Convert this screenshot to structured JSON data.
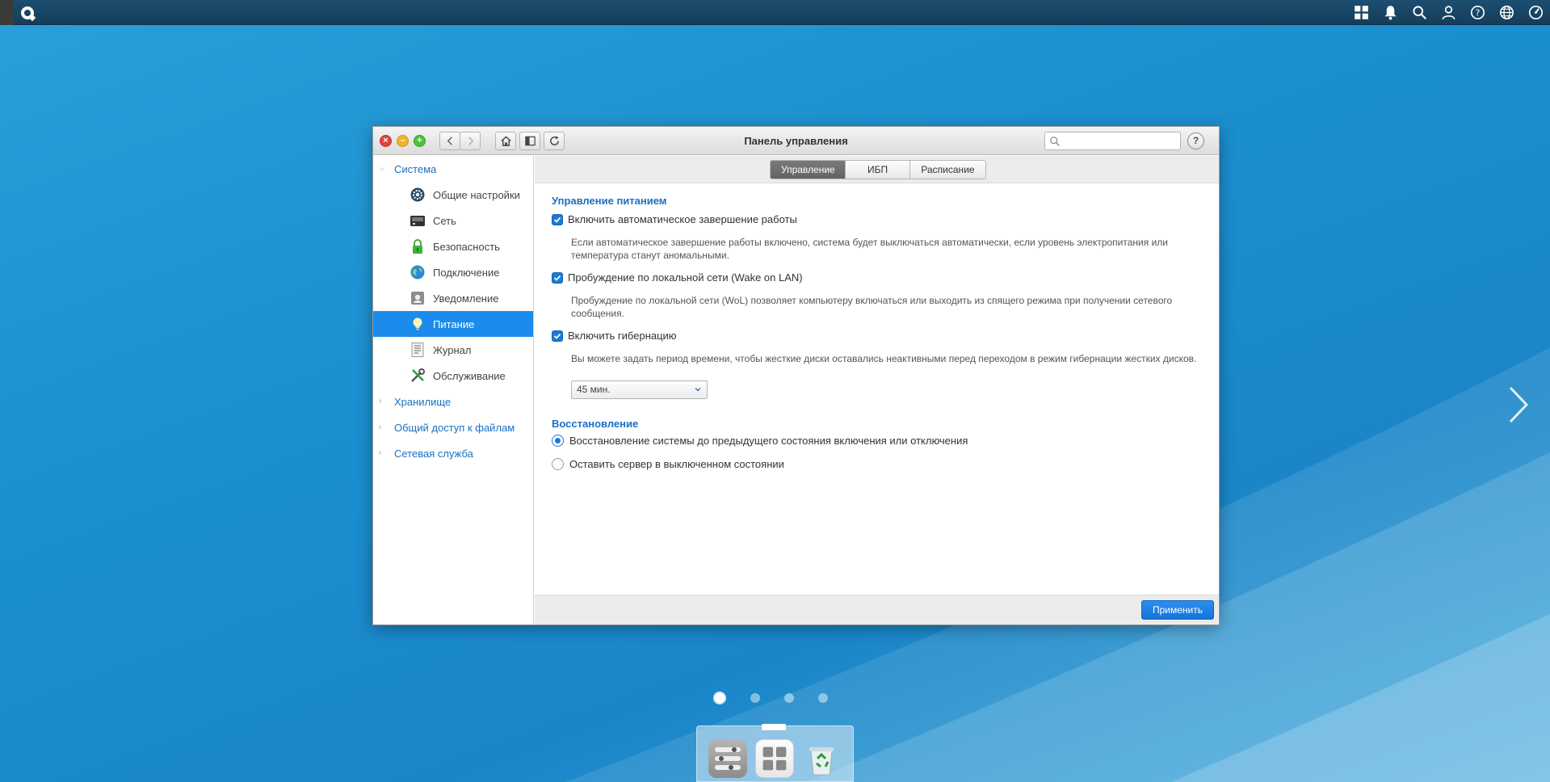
{
  "window": {
    "title": "Панель управления",
    "search_placeholder": ""
  },
  "sidebar": {
    "groups": [
      {
        "label": "Система",
        "expanded": true,
        "items": [
          {
            "label": "Общие настройки",
            "icon": "gear-icon"
          },
          {
            "label": "Сеть",
            "icon": "network-icon"
          },
          {
            "label": "Безопасность",
            "icon": "lock-icon"
          },
          {
            "label": "Подключение",
            "icon": "globe-icon"
          },
          {
            "label": "Уведомление",
            "icon": "notification-icon"
          },
          {
            "label": "Питание",
            "icon": "lightbulb-icon",
            "active": true
          },
          {
            "label": "Журнал",
            "icon": "log-icon"
          },
          {
            "label": "Обслуживание",
            "icon": "tools-icon"
          }
        ]
      },
      {
        "label": "Хранилище",
        "expanded": false
      },
      {
        "label": "Общий доступ к файлам",
        "expanded": false
      },
      {
        "label": "Сетевая служба",
        "expanded": false
      }
    ]
  },
  "tabs": [
    {
      "label": "Управление",
      "active": true
    },
    {
      "label": "ИБП",
      "active": false
    },
    {
      "label": "Расписание",
      "active": false
    }
  ],
  "power": {
    "section_title": "Управление питанием",
    "auto_shutdown": {
      "label": "Включить автоматическое завершение работы",
      "checked": true,
      "description": "Если автоматическое завершение работы включено, система будет выключаться автоматически, если уровень электропитания или температура станут аномальными."
    },
    "wol": {
      "label": "Пробуждение по локальной сети (Wake on LAN)",
      "checked": true,
      "description": "Пробуждение по локальной сети (WoL) позволяет компьютеру включаться или выходить из спящего режима при получении сетевого сообщения."
    },
    "hibernation": {
      "label": "Включить гибернацию",
      "checked": true,
      "description": "Вы можете задать период времени, чтобы жесткие диски оставались неактивными перед переходом в режим гибернации жестких дисков.",
      "period_value": "45 мин."
    }
  },
  "recovery": {
    "section_title": "Восстановление",
    "options": [
      {
        "label": "Восстановление системы до предыдущего состояния включения или отключения",
        "selected": true
      },
      {
        "label": "Оставить сервер в выключенном состоянии",
        "selected": false
      }
    ]
  },
  "footer": {
    "apply_label": "Применить"
  },
  "desktop": {
    "pages_total": 4,
    "current_page": 1
  },
  "colors": {
    "accent": "#1b8cec",
    "section_title": "#1a6fc4",
    "topbar": "#1b4e70"
  }
}
